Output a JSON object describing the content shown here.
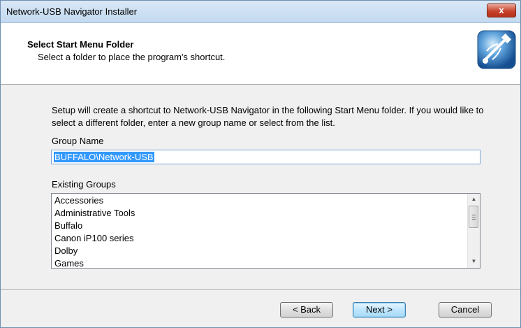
{
  "window": {
    "title": "Network-USB Navigator Installer",
    "close_label": "x"
  },
  "header": {
    "title": "Select Start Menu Folder",
    "subtitle": "Select a folder to place the program's shortcut.",
    "logo_icon": "usb-installer-logo-icon"
  },
  "content": {
    "description": "Setup will create a shortcut to Network-USB Navigator in the following Start Menu folder. If you would like to select a different folder, enter a new group name or select from the list.",
    "group_label": "Group Name",
    "group_value": "BUFFALO\\Network-USB",
    "existing_label": "Existing Groups",
    "existing_groups": [
      "Accessories",
      "Administrative Tools",
      "Buffalo",
      "Canon iP100 series",
      "Dolby",
      "Games"
    ]
  },
  "buttons": {
    "back": "< Back",
    "next": "Next >",
    "cancel": "Cancel"
  },
  "colors": {
    "selection": "#3399ff",
    "close_button": "#c7432b"
  }
}
